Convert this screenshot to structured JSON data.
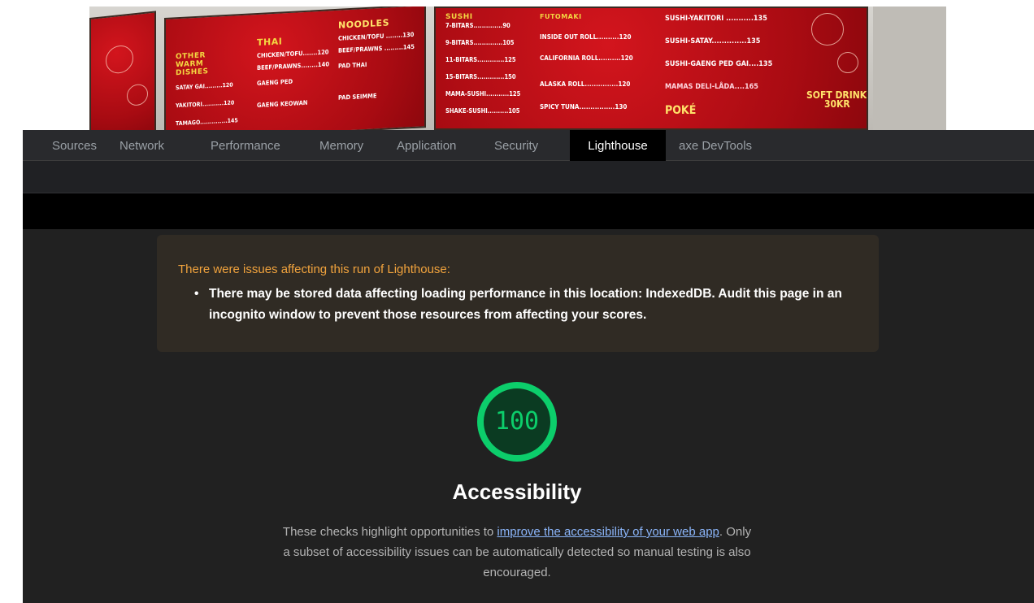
{
  "photo": {
    "board_other": {
      "heading": "OTHER WARM DISHES",
      "lines": [
        "SATAY GAI.........120",
        "YAKITORI...........120",
        "TAMAGO..............145"
      ]
    },
    "board_thai": {
      "heading": "THAI",
      "lines": [
        "CHICKEN/TOFU.......120",
        "BEEF/PRAWNS........140",
        "GAENG PED",
        "GAENG KEOWAN"
      ]
    },
    "board_noodles": {
      "heading": "NOODLES",
      "lines": [
        "CHICKEN/TOFU ........130",
        "BEEF/PRAWNS .........145",
        "PAD THAI",
        "PAD SEIMME"
      ]
    },
    "board_sushi": {
      "heading": "SUSHI",
      "lines": [
        "7-BITARS..............90",
        "9-BITARS..............105",
        "11-BITARS.............125",
        "15-BITARS.............150",
        "MAMA-SUSHI...........125",
        "SHAKE-SUSHI..........105"
      ]
    },
    "board_rolls": {
      "heading": "FUTOMAKI",
      "lines": [
        "INSIDE OUT ROLL..........120",
        "CALIFORNIA ROLL..........120",
        "ALASKA ROLL...............120",
        "SPICY TUNA................130"
      ]
    },
    "board_special": {
      "lines": [
        "SUSHI-YAKITORI ...........135",
        "SUSHI-SATAY..............135",
        "SUSHI-GAENG PED GAI....135",
        "MAMAS DELI-LÅDA....165"
      ],
      "drink": "SOFT DRINK",
      "drink_price": "30KR",
      "poke": "POKÉ"
    }
  },
  "devtools": {
    "tabs": [
      {
        "label": "Sources",
        "active": false
      },
      {
        "label": "Network",
        "active": false
      },
      {
        "label": "Performance",
        "active": false
      },
      {
        "label": "Memory",
        "active": false
      },
      {
        "label": "Application",
        "active": false
      },
      {
        "label": "Security",
        "active": false
      },
      {
        "label": "Lighthouse",
        "active": true
      },
      {
        "label": "axe DevTools",
        "active": false
      }
    ]
  },
  "report": {
    "warning": {
      "title": "There were issues affecting this run of Lighthouse:",
      "items": [
        "There may be stored data affecting loading performance in this location: IndexedDB. Audit this page in an incognito window to prevent those resources from affecting your scores."
      ]
    },
    "score": {
      "value": "100",
      "fraction": 1.0,
      "color": "#0cce6b"
    },
    "category_title": "Accessibility",
    "description": {
      "before": "These checks highlight opportunities to ",
      "link": "improve the accessibility of your web app",
      "after": ". Only a subset of accessibility issues can be automatically detected so manual testing is also encouraged."
    }
  }
}
